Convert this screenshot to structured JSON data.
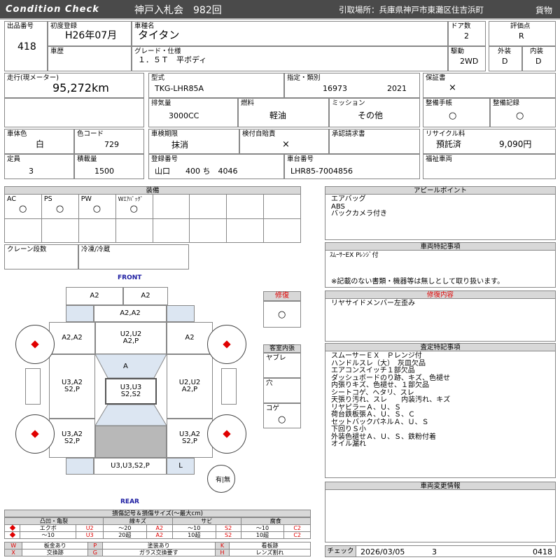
{
  "header": {
    "brand": "Condition Check",
    "auction": "神戸入札会　982回",
    "pickup": "引取場所：兵庫県神戸市東灘区住吉浜町",
    "category": "貨物"
  },
  "row1": {
    "lot_label": "出品番号",
    "lot": "418",
    "first_reg_label": "初度登録",
    "first_reg": "H26年07月",
    "model_label": "車種名",
    "model": "タイタン",
    "doors_label": "ドア数",
    "doors": "2",
    "grade_score_label": "評価点",
    "grade_score": "R",
    "history_label": "車歴",
    "grade_label": "グレード・仕様",
    "grade": "１．５Ｔ　平ボディ",
    "drive_label": "駆動",
    "drive": "2WD",
    "ext_label": "外装",
    "ext": "D",
    "int_label": "内装",
    "int": "D"
  },
  "row2": {
    "mileage_label": "走行(現メーター)",
    "mileage": "95,272km",
    "type_label": "型式",
    "type": "TKG-LHR85A",
    "designation_label": "指定・類別",
    "designation": "16973",
    "designation2": "2021",
    "warranty_label": "保証書",
    "warranty": "×",
    "displacement_label": "排気量",
    "displacement": "3000CC",
    "fuel_label": "燃料",
    "fuel": "軽油",
    "mission_label": "ミッション",
    "mission": "その他",
    "manual_label": "整備手帳",
    "manual": "○",
    "record_label": "整備記録",
    "record": "○"
  },
  "row3": {
    "color_label": "車体色",
    "color": "白",
    "color_code_label": "色コード",
    "color_code": "729",
    "inspection_label": "車検期限",
    "inspection": "抹消",
    "selfcheck_label": "検付自賠責",
    "selfcheck": "×",
    "approval_label": "承認請求書",
    "recycle_label": "リサイクル料",
    "recycle_status": "預託済",
    "recycle_fee": "9,090円",
    "capacity_label": "定員",
    "capacity": "3",
    "load_label": "積載量",
    "load": "1500",
    "plate_label": "登録番号",
    "plate": "山口　　400 ち　4046",
    "chassis_label": "車台番号",
    "chassis": "LHR85-7004856",
    "welfare_label": "福祉車両"
  },
  "equipment": {
    "title": "装備",
    "items": [
      {
        "label": "AC",
        "mark": "○"
      },
      {
        "label": "PS",
        "mark": "○"
      },
      {
        "label": "PW",
        "mark": "○"
      },
      {
        "label": "Wｴｱﾊﾞｯｸﾞ",
        "mark": "○"
      }
    ],
    "crane_label": "クレーン段数",
    "freezer_label": "冷凍/冷蔵"
  },
  "appeal": {
    "title": "アピールポイント",
    "text": "エアバッグ\nABS\nバックカメラ付き"
  },
  "special": {
    "title": "車両特記事項",
    "line1": "ｽﾑｰｻｰEX Pﾚﾝｼﾞ付",
    "line2": "※記載のない書類・機器等は無しとして取り扱います。"
  },
  "repair_content": {
    "title": "修復内容",
    "text": "リヤサイドメンバー左歪み"
  },
  "inspection_notes": {
    "title": "査定特記事項",
    "text": "スムーサーＥＸ　Ｐレンジ付\nハンドルスレ（大）　灰皿欠品\nエアコンスイッチ１部欠品\nダッシュボードのり跡、キズ、色褪せ\n内張りキズ、色褪せ、１部欠品\nシートコゲ、ヘタリ、スレ\n天張り汚れ、スレ　　内装汚れ、キズ\nリヤピラーＡ、Ｕ、Ｓ\n荷台鉄板張Ａ、Ｕ、Ｓ、Ｃ\nセットバックパネルＡ、Ｕ、Ｓ\n下回りＳ小\n外装色褪せＡ、Ｕ、Ｓ、鉄粉付着\nオイル漏れ"
  },
  "change_info": {
    "title": "車両変更情報"
  },
  "check": {
    "label": "チェック",
    "date": "2026/03/05",
    "num": "3",
    "code": "0418"
  },
  "repair": {
    "title": "修復",
    "mark": "○"
  },
  "interior": {
    "title": "客室内張",
    "item1": "ヤブレ",
    "item2": "穴",
    "item3": "コゲ",
    "mark3": "○"
  },
  "diagram": {
    "front": "FRONT",
    "rear": "REAR",
    "cells": {
      "a2_left": "A2",
      "a2_right": "A2",
      "a2a2_top": "A2,A2",
      "fl": "A2,A2",
      "hood": "U2,U2\nA2,P",
      "fr": "A2",
      "glass": "A",
      "l_door": "U3,A2\nS2,P",
      "r_door": "U2,U2\nA2,P",
      "roof": "U3,U3\nS2,S2",
      "rl": "U3,A2\nS2,P",
      "rr": "U3,A2\nS2,P",
      "bottom": "U3,U3,S2,P",
      "l": "L",
      "tail": "有|無"
    }
  },
  "legend": {
    "title": "損傷記号＆損傷サイズ(〜最大cm)",
    "heads": [
      "凸凹・亀裂",
      "線キズ",
      "サビ",
      "腐食"
    ],
    "row1": [
      "エクボ",
      "U2",
      "〜20",
      "A2",
      "〜10",
      "S2",
      "〜10",
      "C2",
      "〜10"
    ],
    "row2": [
      "〜10",
      "U3",
      "20超",
      "A2",
      "10超",
      "S2",
      "10超",
      "C2",
      "10超"
    ],
    "codes": [
      [
        "W",
        "板金あり",
        "P",
        "塗装あり",
        "K",
        "看板跡"
      ],
      [
        "X",
        "交換跡",
        "G",
        "ガラス交換要す",
        "H",
        "レンズ割れ"
      ]
    ]
  },
  "colors": {
    "header_bg": "#4a4a4a",
    "accent_red": "#e00000",
    "front_blue": "#1a1aa0",
    "section_bg": "#d8d8d8",
    "panel_blue": "#dce6f2"
  }
}
